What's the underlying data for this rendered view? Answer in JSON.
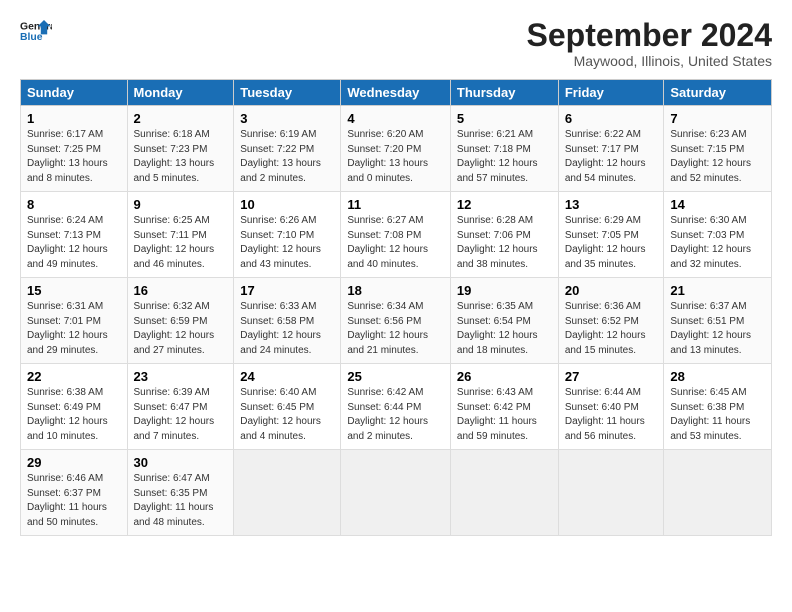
{
  "header": {
    "logo_line1": "General",
    "logo_line2": "Blue",
    "month_title": "September 2024",
    "location": "Maywood, Illinois, United States"
  },
  "weekdays": [
    "Sunday",
    "Monday",
    "Tuesday",
    "Wednesday",
    "Thursday",
    "Friday",
    "Saturday"
  ],
  "weeks": [
    [
      {
        "day": "1",
        "info": "Sunrise: 6:17 AM\nSunset: 7:25 PM\nDaylight: 13 hours\nand 8 minutes."
      },
      {
        "day": "2",
        "info": "Sunrise: 6:18 AM\nSunset: 7:23 PM\nDaylight: 13 hours\nand 5 minutes."
      },
      {
        "day": "3",
        "info": "Sunrise: 6:19 AM\nSunset: 7:22 PM\nDaylight: 13 hours\nand 2 minutes."
      },
      {
        "day": "4",
        "info": "Sunrise: 6:20 AM\nSunset: 7:20 PM\nDaylight: 13 hours\nand 0 minutes."
      },
      {
        "day": "5",
        "info": "Sunrise: 6:21 AM\nSunset: 7:18 PM\nDaylight: 12 hours\nand 57 minutes."
      },
      {
        "day": "6",
        "info": "Sunrise: 6:22 AM\nSunset: 7:17 PM\nDaylight: 12 hours\nand 54 minutes."
      },
      {
        "day": "7",
        "info": "Sunrise: 6:23 AM\nSunset: 7:15 PM\nDaylight: 12 hours\nand 52 minutes."
      }
    ],
    [
      {
        "day": "8",
        "info": "Sunrise: 6:24 AM\nSunset: 7:13 PM\nDaylight: 12 hours\nand 49 minutes."
      },
      {
        "day": "9",
        "info": "Sunrise: 6:25 AM\nSunset: 7:11 PM\nDaylight: 12 hours\nand 46 minutes."
      },
      {
        "day": "10",
        "info": "Sunrise: 6:26 AM\nSunset: 7:10 PM\nDaylight: 12 hours\nand 43 minutes."
      },
      {
        "day": "11",
        "info": "Sunrise: 6:27 AM\nSunset: 7:08 PM\nDaylight: 12 hours\nand 40 minutes."
      },
      {
        "day": "12",
        "info": "Sunrise: 6:28 AM\nSunset: 7:06 PM\nDaylight: 12 hours\nand 38 minutes."
      },
      {
        "day": "13",
        "info": "Sunrise: 6:29 AM\nSunset: 7:05 PM\nDaylight: 12 hours\nand 35 minutes."
      },
      {
        "day": "14",
        "info": "Sunrise: 6:30 AM\nSunset: 7:03 PM\nDaylight: 12 hours\nand 32 minutes."
      }
    ],
    [
      {
        "day": "15",
        "info": "Sunrise: 6:31 AM\nSunset: 7:01 PM\nDaylight: 12 hours\nand 29 minutes."
      },
      {
        "day": "16",
        "info": "Sunrise: 6:32 AM\nSunset: 6:59 PM\nDaylight: 12 hours\nand 27 minutes."
      },
      {
        "day": "17",
        "info": "Sunrise: 6:33 AM\nSunset: 6:58 PM\nDaylight: 12 hours\nand 24 minutes."
      },
      {
        "day": "18",
        "info": "Sunrise: 6:34 AM\nSunset: 6:56 PM\nDaylight: 12 hours\nand 21 minutes."
      },
      {
        "day": "19",
        "info": "Sunrise: 6:35 AM\nSunset: 6:54 PM\nDaylight: 12 hours\nand 18 minutes."
      },
      {
        "day": "20",
        "info": "Sunrise: 6:36 AM\nSunset: 6:52 PM\nDaylight: 12 hours\nand 15 minutes."
      },
      {
        "day": "21",
        "info": "Sunrise: 6:37 AM\nSunset: 6:51 PM\nDaylight: 12 hours\nand 13 minutes."
      }
    ],
    [
      {
        "day": "22",
        "info": "Sunrise: 6:38 AM\nSunset: 6:49 PM\nDaylight: 12 hours\nand 10 minutes."
      },
      {
        "day": "23",
        "info": "Sunrise: 6:39 AM\nSunset: 6:47 PM\nDaylight: 12 hours\nand 7 minutes."
      },
      {
        "day": "24",
        "info": "Sunrise: 6:40 AM\nSunset: 6:45 PM\nDaylight: 12 hours\nand 4 minutes."
      },
      {
        "day": "25",
        "info": "Sunrise: 6:42 AM\nSunset: 6:44 PM\nDaylight: 12 hours\nand 2 minutes."
      },
      {
        "day": "26",
        "info": "Sunrise: 6:43 AM\nSunset: 6:42 PM\nDaylight: 11 hours\nand 59 minutes."
      },
      {
        "day": "27",
        "info": "Sunrise: 6:44 AM\nSunset: 6:40 PM\nDaylight: 11 hours\nand 56 minutes."
      },
      {
        "day": "28",
        "info": "Sunrise: 6:45 AM\nSunset: 6:38 PM\nDaylight: 11 hours\nand 53 minutes."
      }
    ],
    [
      {
        "day": "29",
        "info": "Sunrise: 6:46 AM\nSunset: 6:37 PM\nDaylight: 11 hours\nand 50 minutes."
      },
      {
        "day": "30",
        "info": "Sunrise: 6:47 AM\nSunset: 6:35 PM\nDaylight: 11 hours\nand 48 minutes."
      },
      {
        "day": "",
        "info": ""
      },
      {
        "day": "",
        "info": ""
      },
      {
        "day": "",
        "info": ""
      },
      {
        "day": "",
        "info": ""
      },
      {
        "day": "",
        "info": ""
      }
    ]
  ]
}
